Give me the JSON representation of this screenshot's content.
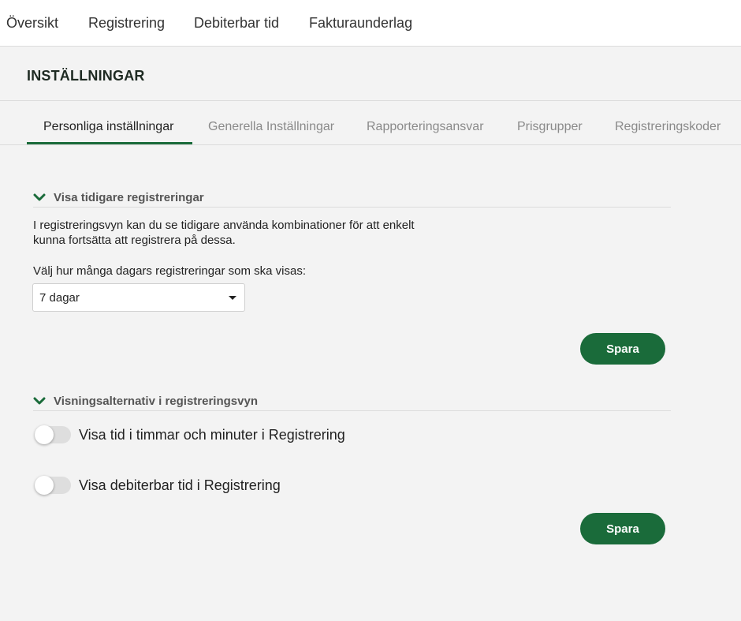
{
  "top_nav": {
    "items": [
      "Översikt",
      "Registrering",
      "Debiterbar tid",
      "Fakturaunderlag"
    ]
  },
  "page": {
    "title": "INSTÄLLNINGAR"
  },
  "tabs": {
    "items": [
      "Personliga inställningar",
      "Generella Inställningar",
      "Rapporteringsansvar",
      "Prisgrupper",
      "Registreringskoder"
    ],
    "active": "Personliga inställningar"
  },
  "section1": {
    "title": "Visa tidigare registreringar",
    "description_line1": "I registreringsvyn kan du se tidigare använda kombinationer för att enkelt",
    "description_line2": "kunna fortsätta att registrera på dessa.",
    "select_label": "Välj hur många dagars registreringar som ska visas:",
    "select_value": "7 dagar",
    "save_label": "Spara"
  },
  "section2": {
    "title": "Visningsalternativ i registreringsvyn",
    "toggles": [
      {
        "label": "Visa tid i timmar och minuter i Registrering",
        "on": false
      },
      {
        "label": "Visa debiterbar tid i Registrering",
        "on": false
      }
    ],
    "save_label": "Spara"
  },
  "colors": {
    "accent": "#1a6b3a",
    "background": "#f3f3f3",
    "toggle_off": "#dedede"
  }
}
